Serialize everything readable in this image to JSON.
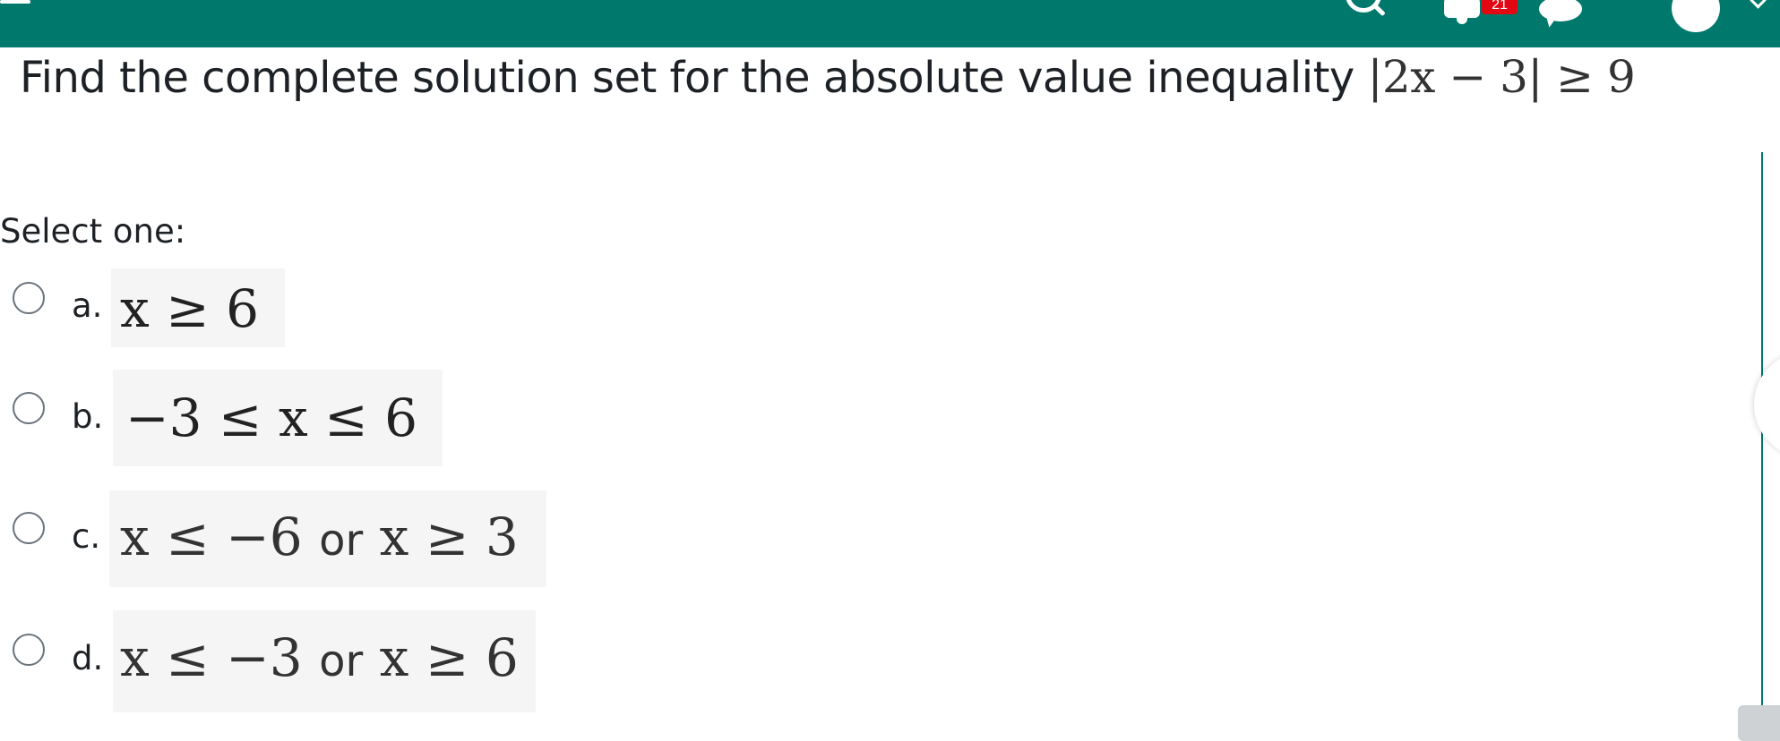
{
  "header": {
    "notification_count": "21",
    "brand_color": "#00786b",
    "badge_color": "#e30613",
    "icons": [
      "menu-icon",
      "search-icon",
      "bell-icon",
      "chat-icon",
      "avatar",
      "caret-down-icon"
    ]
  },
  "question": {
    "text": "Find the complete solution set for the absolute value inequality ",
    "math": "|2x − 3| ≥ 9"
  },
  "prompt": "Select one:",
  "options": [
    {
      "letter": "a.",
      "answer": "x ≥ 6"
    },
    {
      "letter": "b.",
      "answer": "−3 ≤ x ≤ 6"
    },
    {
      "letter": "c.",
      "answer_part1": "x ≤ −6",
      "or": "or",
      "answer_part2": "x ≥ 3"
    },
    {
      "letter": "d.",
      "answer_part1": "x ≤ −3",
      "or": "or",
      "answer_part2": "x ≥ 6"
    }
  ]
}
